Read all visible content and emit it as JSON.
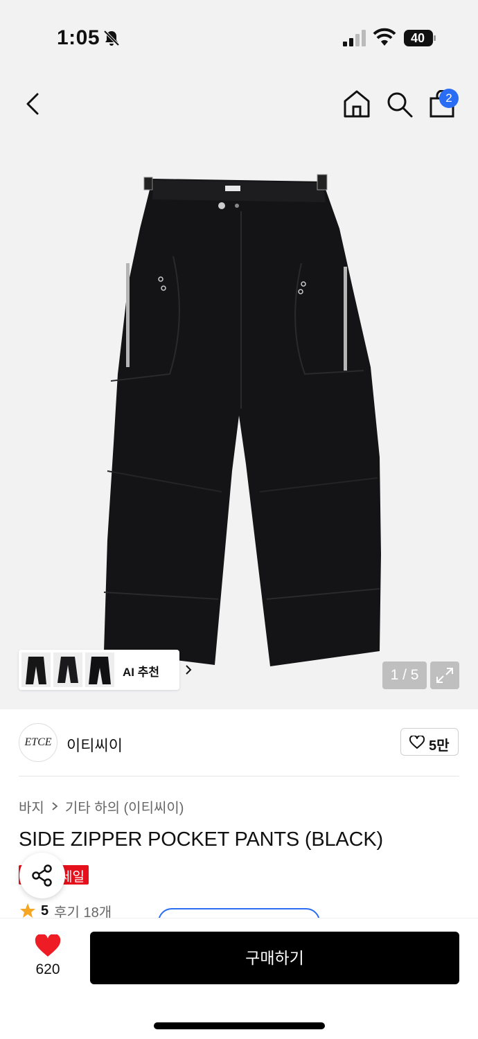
{
  "status_bar": {
    "time": "1:05",
    "battery_level": "40",
    "icons": [
      "bell-off-icon",
      "signal-icon",
      "wifi-icon",
      "battery-icon"
    ]
  },
  "nav": {
    "icons": [
      "back-arrow-icon",
      "home-icon",
      "search-icon",
      "shopping-bag-icon"
    ],
    "cart_count": "2"
  },
  "gallery": {
    "ai_recommend_label": "AI 추천",
    "page_indicator": "1 / 5",
    "thumbnail_count": 3
  },
  "brand": {
    "logo_text": "ETCE",
    "name": "이티씨이",
    "likes": "5만"
  },
  "product": {
    "breadcrumb": [
      "바지",
      "기타 하의 (이티씨이)"
    ],
    "title": "SIDE ZIPPER POCKET PANTS (BLACK)",
    "badge": "세일",
    "rating": "5",
    "reviews": "후기 18개"
  },
  "bottom_bar": {
    "wish_count": "620",
    "buy_label": "구매하기"
  },
  "colors": {
    "accent_blue": "#2a6df5",
    "sale_red": "#e5101b",
    "heart_red": "#ee1c25",
    "star_orange": "#f5a623"
  }
}
